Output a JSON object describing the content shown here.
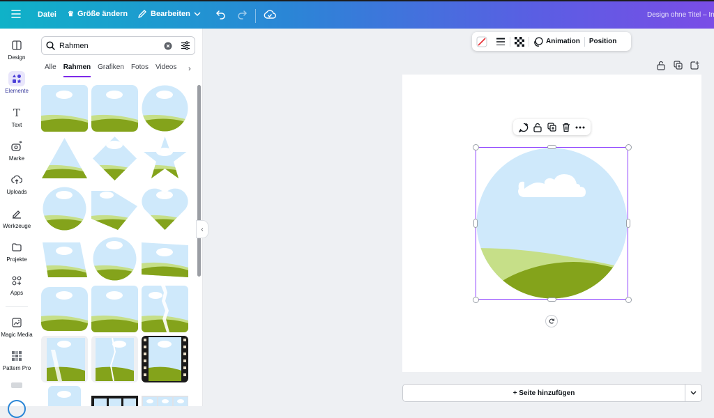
{
  "topbar": {
    "file_label": "Datei",
    "resize_label": "Größe ändern",
    "edit_label": "Bearbeiten",
    "doc_title": "Design ohne Titel – In"
  },
  "rail": {
    "items": [
      {
        "label": "Design",
        "icon": "layout-icon"
      },
      {
        "label": "Elemente",
        "icon": "shapes-icon",
        "active": true
      },
      {
        "label": "Text",
        "icon": "text-icon"
      },
      {
        "label": "Marke",
        "icon": "brand-icon"
      },
      {
        "label": "Uploads",
        "icon": "cloud-upload-icon"
      },
      {
        "label": "Werkzeuge",
        "icon": "pen-tool-icon"
      },
      {
        "label": "Projekte",
        "icon": "folder-icon"
      },
      {
        "label": "Apps",
        "icon": "apps-icon"
      },
      {
        "label": "Magic Media",
        "icon": "magic-media-icon"
      },
      {
        "label": "Pattern Pro",
        "icon": "pattern-icon"
      }
    ]
  },
  "panel": {
    "search_value": "Rahmen",
    "tabs": [
      "Alle",
      "Rahmen",
      "Grafiken",
      "Fotos",
      "Videos"
    ],
    "active_tab": "Rahmen"
  },
  "context_toolbar": {
    "animation_label": "Animation",
    "position_label": "Position"
  },
  "canvas": {
    "add_page_label": "+ Seite hinzufügen"
  },
  "colors": {
    "accent": "#8b3dff",
    "sky": "#cfe9fb",
    "hill_dark": "#84a31b",
    "hill_light": "#c6df88"
  }
}
